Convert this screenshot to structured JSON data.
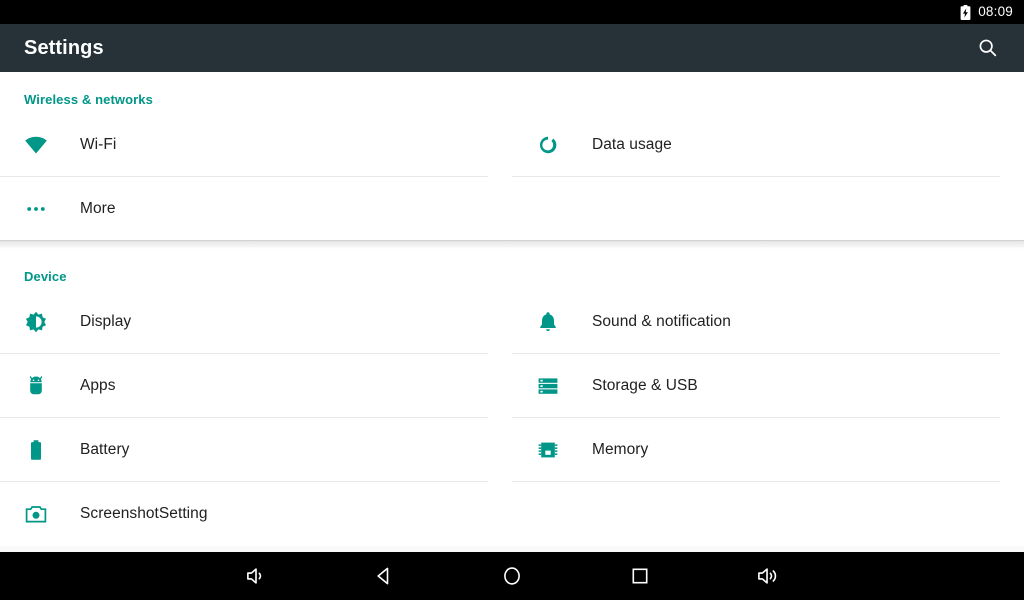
{
  "status_bar": {
    "battery_icon": "battery-charging-icon",
    "time": "08:09"
  },
  "app_bar": {
    "title": "Settings",
    "search_icon": "search-icon",
    "background_color": "#263238"
  },
  "theme": {
    "accent_color": "#009688",
    "text_color": "#212121",
    "divider_color": "#e8e8e8",
    "page_background": "#ffffff"
  },
  "sections": [
    {
      "title": "Wireless & networks",
      "items": [
        {
          "label": "Wi-Fi",
          "icon": "wifi-icon",
          "column": "left"
        },
        {
          "label": "Data usage",
          "icon": "data-usage-icon",
          "column": "right"
        },
        {
          "label": "More",
          "icon": "more-dots-icon",
          "column": "left"
        }
      ]
    },
    {
      "title": "Device",
      "items": [
        {
          "label": "Display",
          "icon": "brightness-icon",
          "column": "left"
        },
        {
          "label": "Sound & notification",
          "icon": "bell-icon",
          "column": "right"
        },
        {
          "label": "Apps",
          "icon": "android-icon",
          "column": "left"
        },
        {
          "label": "Storage & USB",
          "icon": "storage-icon",
          "column": "right"
        },
        {
          "label": "Battery",
          "icon": "battery-icon",
          "column": "left"
        },
        {
          "label": "Memory",
          "icon": "memory-chip-icon",
          "column": "right"
        },
        {
          "label": "ScreenshotSetting",
          "icon": "camera-icon",
          "column": "left"
        }
      ]
    }
  ],
  "nav_bar": {
    "items": [
      {
        "name": "volume-down-icon",
        "label": "Volume down"
      },
      {
        "name": "back-icon",
        "label": "Back"
      },
      {
        "name": "home-icon",
        "label": "Home"
      },
      {
        "name": "recents-icon",
        "label": "Recent apps"
      },
      {
        "name": "volume-up-icon",
        "label": "Volume up"
      }
    ]
  }
}
